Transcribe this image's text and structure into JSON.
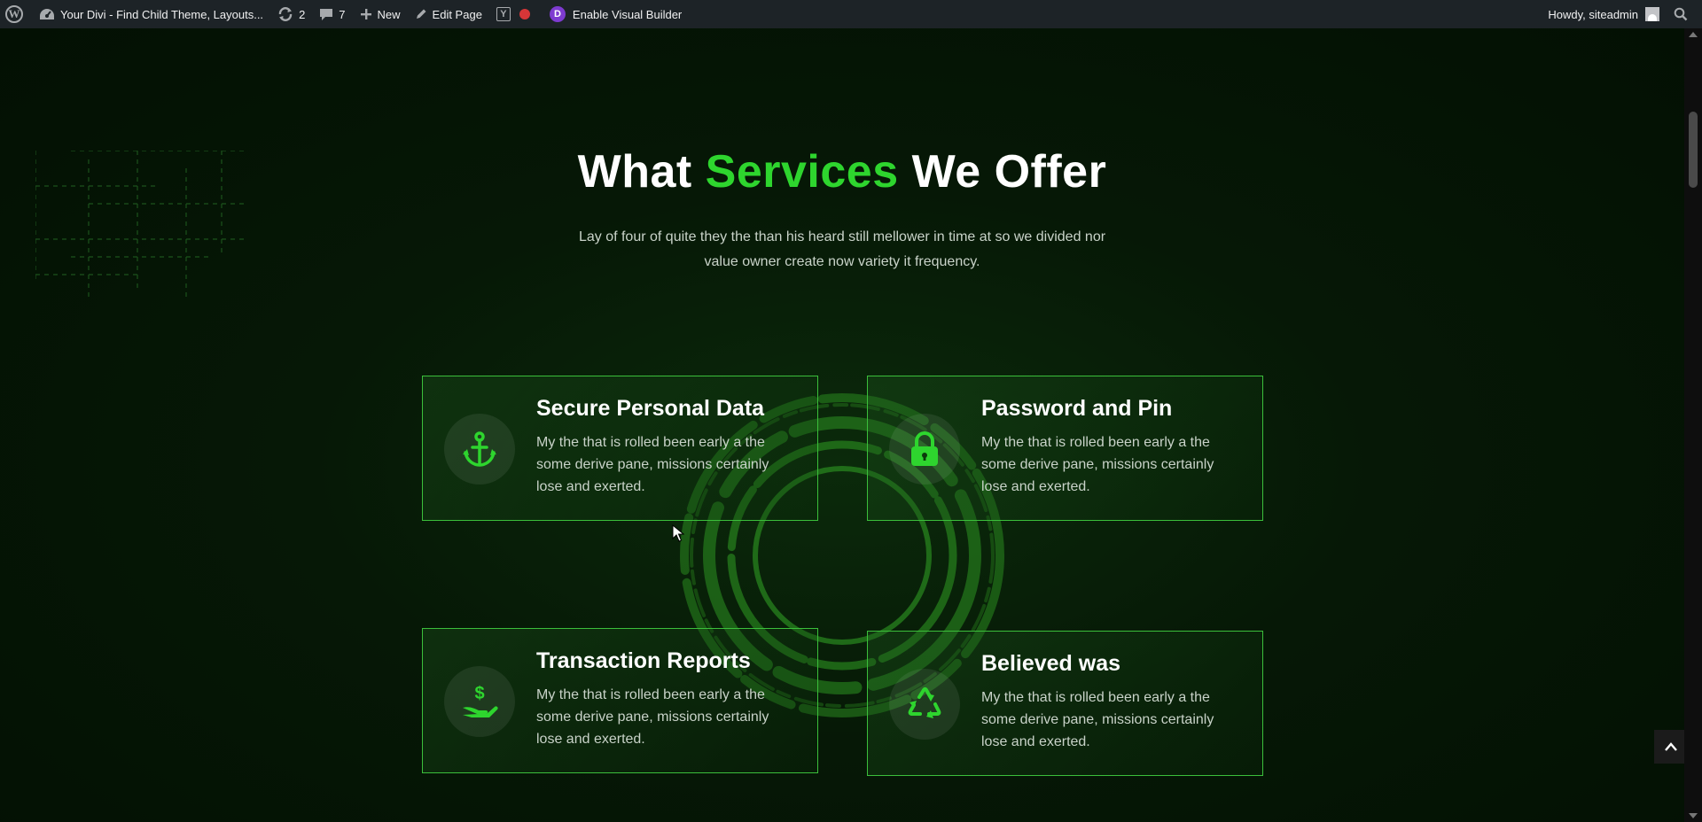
{
  "adminbar": {
    "site_title": "Your Divi - Find Child Theme, Layouts...",
    "updates_count": "2",
    "comments_count": "7",
    "new_label": "New",
    "edit_label": "Edit Page",
    "visual_builder_label": "Enable Visual Builder",
    "divi_letter": "D",
    "yoast_letter": "Y",
    "wp_letter": "W",
    "howdy": "Howdy, siteadmin"
  },
  "section": {
    "heading_before": "What ",
    "heading_accent": "Services",
    "heading_after": " We Offer",
    "subtitle": "Lay of four of quite they the than his heard still mellower in time at so we divided nor value owner create now variety it frequency."
  },
  "services": [
    {
      "title": "Secure Personal Data",
      "desc": "My the that is rolled been early a the some derive pane, missions certainly lose and exerted.",
      "icon": "anchor-icon"
    },
    {
      "title": "Password and Pin",
      "desc": "My the that is rolled been early a the some derive pane, missions certainly lose and exerted.",
      "icon": "lock-icon"
    },
    {
      "title": "Transaction Reports",
      "desc": "My the that is rolled been early a the some derive pane, missions certainly lose and exerted.",
      "icon": "hand-dollar-icon"
    },
    {
      "title": "Believed was",
      "desc": "My the that is rolled been early a the some derive pane, missions certainly lose and exerted.",
      "icon": "recycle-icon"
    }
  ],
  "colors": {
    "accent": "#2ed52e",
    "background": "#041204",
    "card_border": "#3bbf3b",
    "adminbar": "#1d2327"
  }
}
